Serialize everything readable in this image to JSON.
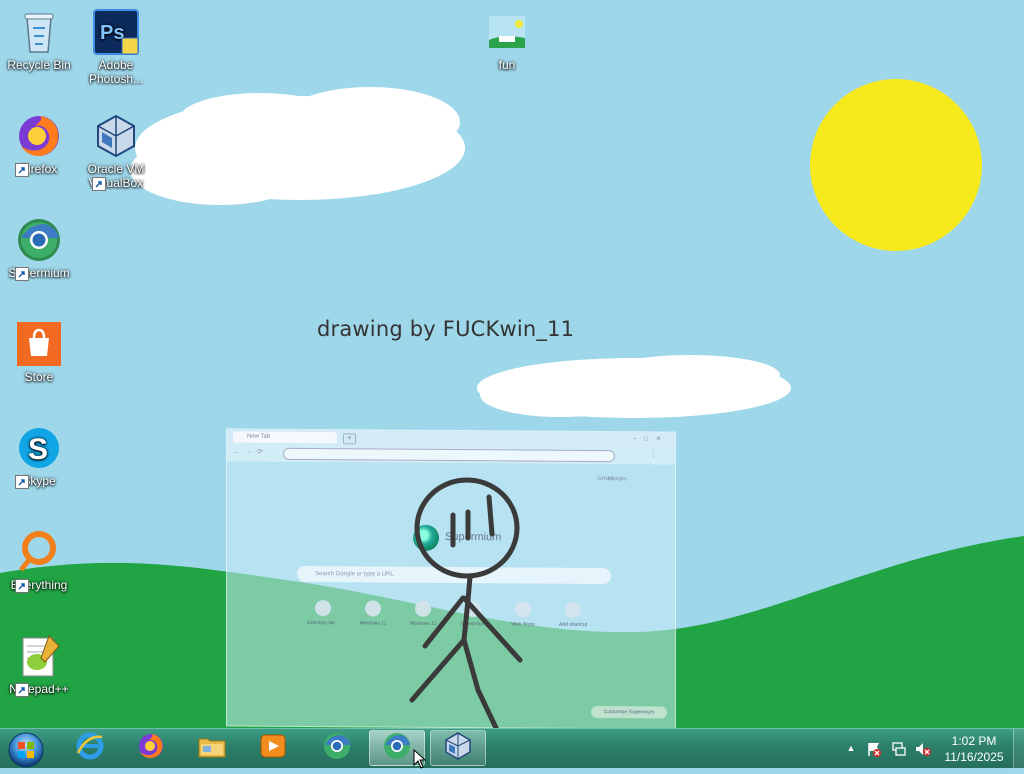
{
  "desktop": {
    "icons": [
      {
        "label": "Recycle Bin",
        "icon": "recycle-bin-icon"
      },
      {
        "label": "Adobe Photosh...",
        "icon": "photoshop-icon"
      },
      {
        "label": "fun",
        "icon": "image-file-icon"
      },
      {
        "label": "Firefox",
        "icon": "firefox-icon"
      },
      {
        "label": "Oracle VM VirtualBox",
        "icon": "virtualbox-icon"
      },
      {
        "label": "Supermium",
        "icon": "supermium-icon"
      },
      {
        "label": "Store",
        "icon": "store-icon"
      },
      {
        "label": "Skype",
        "icon": "skype-icon"
      },
      {
        "label": "Everything",
        "icon": "everything-icon"
      },
      {
        "label": "Notepad++",
        "icon": "notepadpp-icon"
      }
    ],
    "wallpaper_text": "drawing by FUCKwin_11",
    "colors": {
      "sky": "#9fd7ea",
      "grass": "#21a444",
      "sun": "#f7ea1c",
      "cloud": "#ffffff"
    }
  },
  "ghost_browser": {
    "tab_title": "New Tab",
    "new_tab": "+",
    "brand": "Supermium",
    "search_placeholder": "Search Google or type a URL",
    "gmail_link": "Gmail",
    "images_link": "Images",
    "shortcuts": [
      "Directory list...",
      "Windows 11",
      "Windows 11",
      "Supermium",
      "Web Store",
      "Add shortcut"
    ],
    "customize_label": "Customize Supermium"
  },
  "taskbar": {
    "start_label": "Start",
    "pinned": [
      {
        "name": "Internet Explorer",
        "icon": "ie-icon"
      },
      {
        "name": "Firefox",
        "icon": "firefox-icon"
      },
      {
        "name": "File Explorer",
        "icon": "folder-icon"
      },
      {
        "name": "Windows Media Player",
        "icon": "media-player-icon"
      },
      {
        "name": "Supermium",
        "icon": "supermium-icon"
      },
      {
        "name": "Supermium (active)",
        "icon": "supermium-icon"
      },
      {
        "name": "Oracle VM VirtualBox",
        "icon": "virtualbox-icon"
      }
    ],
    "tray": {
      "icons": [
        "show-hidden-icons-arrow",
        "action-center-flag-icon",
        "network-icon",
        "volume-muted-icon"
      ]
    },
    "clock": {
      "time": "1:02 PM",
      "date": "11/16/2025"
    }
  }
}
